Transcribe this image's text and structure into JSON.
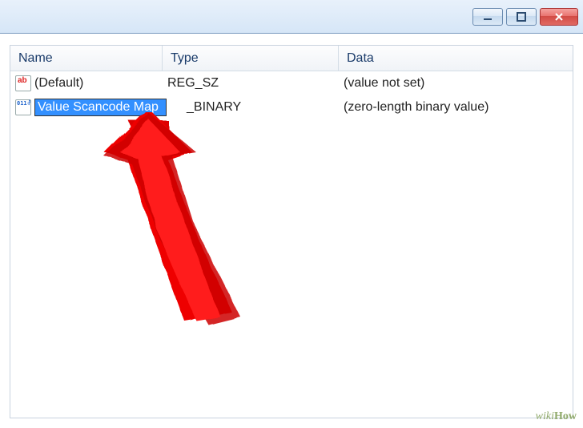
{
  "window": {
    "minimize_icon": "minimize",
    "maximize_icon": "maximize",
    "close_icon": "close"
  },
  "columns": {
    "name": "Name",
    "type": "Type",
    "data": "Data"
  },
  "rows": [
    {
      "icon": "reg-sz-icon",
      "name": "(Default)",
      "type": "REG_SZ",
      "data": "(value not set)",
      "editing": false
    },
    {
      "icon": "reg-binary-icon",
      "name": "Value Scancode Map",
      "type_suffix": "_BINARY",
      "data": "(zero-length binary value)",
      "editing": true
    }
  ],
  "watermark": "wikiHow"
}
